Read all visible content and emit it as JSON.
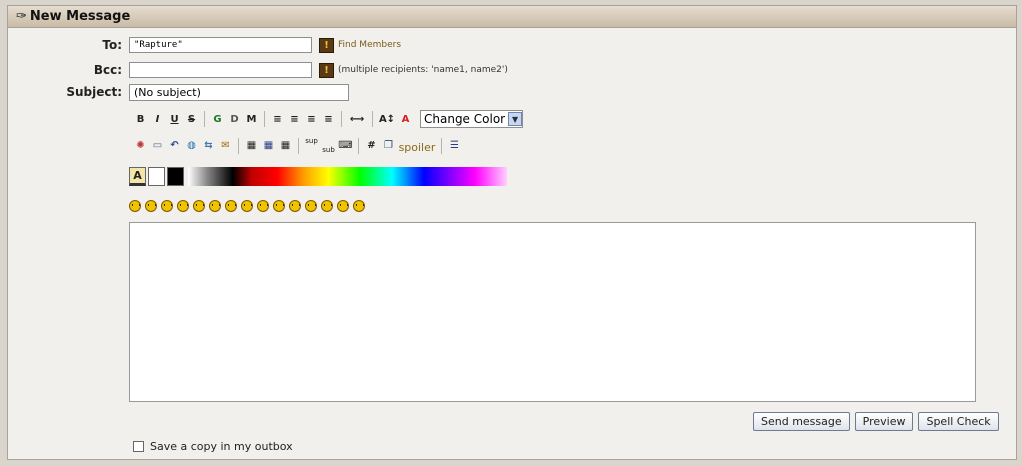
{
  "window": {
    "title": "New Message",
    "title_icon": "pen-icon"
  },
  "form": {
    "to_label": "To:",
    "to_value": "\"Rapture\"",
    "find_members": "Find Members",
    "bcc_label": "Bcc:",
    "bcc_value": "",
    "bcc_hint": "(multiple recipients: 'name1, name2')",
    "subject_label": "Subject:",
    "subject_value": "(No subject)"
  },
  "toolbar": {
    "bold": "B",
    "italic": "I",
    "underline": "U",
    "strike": "S",
    "glow": "G",
    "shadow": "D",
    "marquee": "M",
    "align_left": "≡",
    "align_justify": "≡",
    "align_center": "≡",
    "align_right": "≡",
    "hr": "⟷",
    "font_size": "A↕",
    "font_color": "A",
    "change_color": "Change Color",
    "sup": "sup",
    "sub": "sub",
    "code": "#",
    "spoiler": "spoiler",
    "list": "☰"
  },
  "colors": {
    "accent_title": "#c9bba6",
    "spoiler": "#8a6a1a",
    "smiley": "#f2c200"
  },
  "smiley_count": 15,
  "message_body": "",
  "actions": {
    "send": "Send message",
    "preview": "Preview",
    "spell": "Spell Check"
  },
  "save_copy_label": "Save a copy in my outbox"
}
